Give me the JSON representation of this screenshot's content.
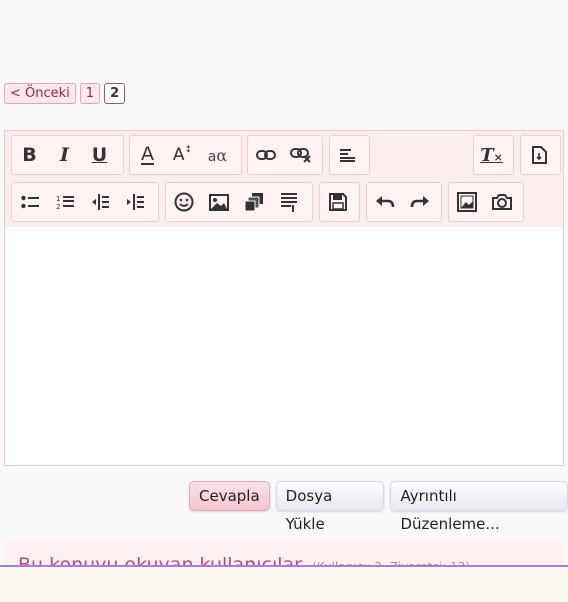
{
  "pagination": {
    "prev_label": "< Önceki",
    "pages": [
      "1",
      "2"
    ],
    "current": "2"
  },
  "toolbar": {
    "row1": {
      "formatting": [
        {
          "name": "bold-button",
          "glyph": "B"
        },
        {
          "name": "italic-button",
          "glyph": "I"
        },
        {
          "name": "underline-button",
          "glyph": "U"
        }
      ],
      "text_style": [
        {
          "name": "font-color-button",
          "glyph": "A"
        },
        {
          "name": "font-size-button",
          "glyph": "A"
        },
        {
          "name": "font-family-button",
          "glyph": "a"
        }
      ]
    },
    "icons": [
      "bold-icon",
      "italic-icon",
      "underline-icon",
      "font-color-icon",
      "font-size-icon",
      "font-family-icon",
      "link-icon",
      "unlink-icon",
      "align-icon",
      "remove-format-icon",
      "toggle-bbcode-icon",
      "bullet-list-icon",
      "numbered-list-icon",
      "outdent-icon",
      "indent-icon",
      "smilies-icon",
      "image-icon",
      "media-icon",
      "quote-icon",
      "save-draft-icon",
      "undo-icon",
      "redo-icon",
      "insert-image-icon",
      "screenshot-camera-icon"
    ]
  },
  "editor": {
    "content": ""
  },
  "actions": {
    "reply": "Cevapla",
    "upload": "Dosya Yükle",
    "advanced": "Ayrıntılı Düzenleme..."
  },
  "who_reading": {
    "title": "Bu konuyu okuyan kullanıcılar",
    "subtitle": "(Kullanıcı: 2, Ziyaretçi: 13)"
  },
  "colors": {
    "accent": "#b04a8e",
    "toolbar_bg": "#fdeeee",
    "primary_button": "#f4c5d0"
  }
}
